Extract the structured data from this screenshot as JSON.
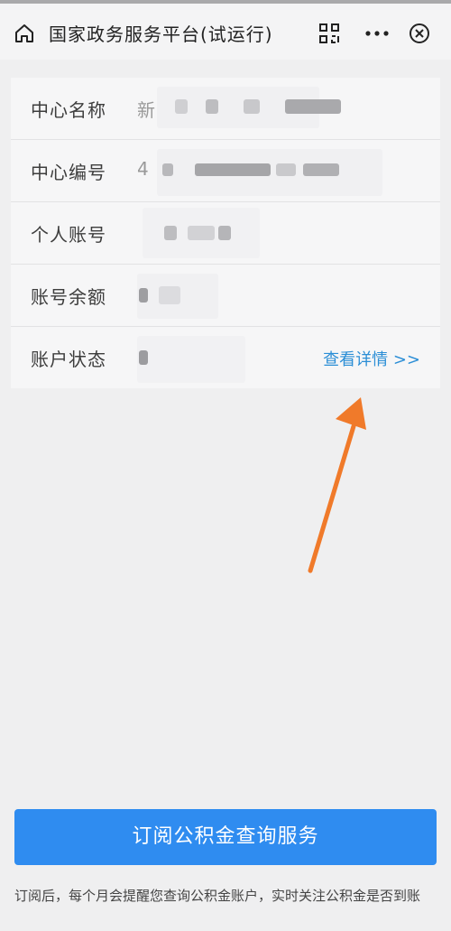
{
  "topbar": {
    "title": "国家政务服务平台(试运行)"
  },
  "account_info": {
    "rows": [
      {
        "label": "中心名称",
        "value": "新"
      },
      {
        "label": "中心编号",
        "value": "4"
      },
      {
        "label": "个人账号",
        "value": ""
      },
      {
        "label": "账号余额",
        "value": ""
      },
      {
        "label": "账户状态",
        "value": "",
        "link": "查看详情 >>"
      }
    ]
  },
  "subscribe": {
    "button_label": "订阅公积金查询服务",
    "note": "订阅后，每个月会提醒您查询公积金账户，实时关注公积金是否到账"
  },
  "colors": {
    "accent": "#2f8cf0",
    "link": "#2b8ed6",
    "arrow": "#f07a2a"
  },
  "icons": [
    "home-icon",
    "scan-icon",
    "more-icon",
    "close-icon",
    "arrow-annotation"
  ]
}
